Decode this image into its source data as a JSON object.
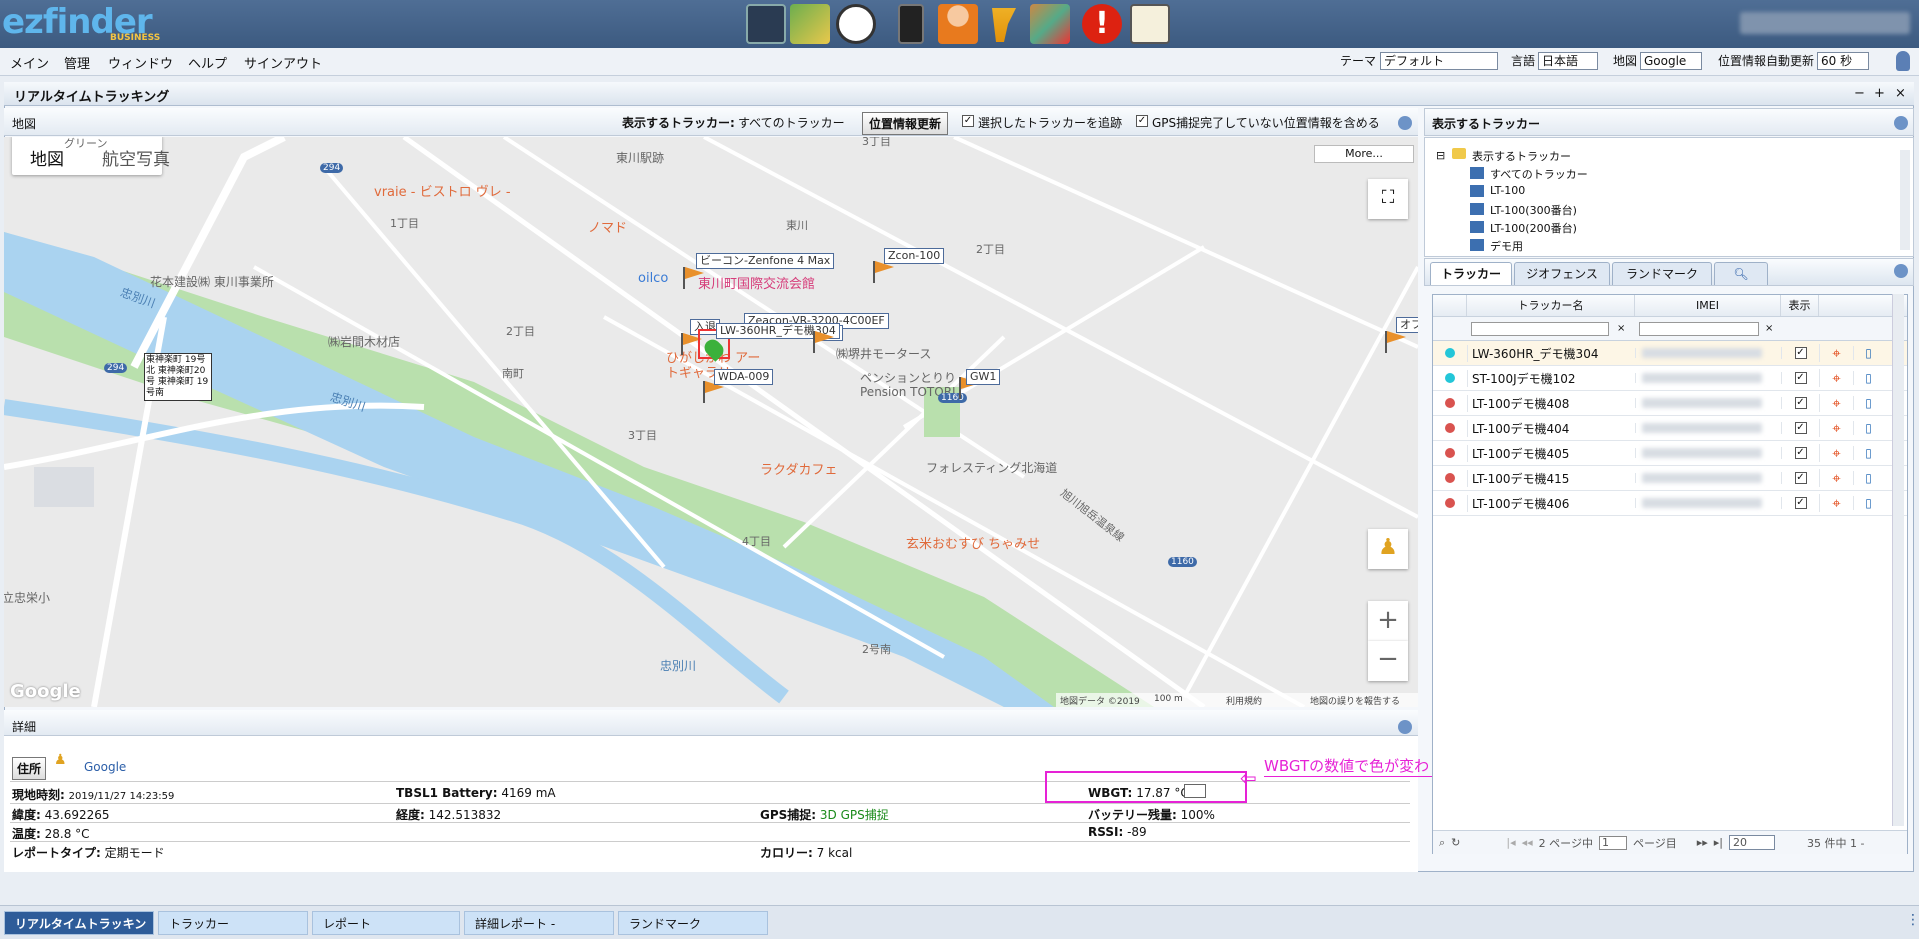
{
  "app": {
    "logo": "ezfinder",
    "logo_sub": "BUSINESS"
  },
  "menu": [
    "メイン",
    "管理",
    "ウィンドウ",
    "ヘルプ",
    "サインアウト"
  ],
  "settings": {
    "theme_label": "テーマ",
    "theme_value": "デフォルト",
    "lang_label": "言語",
    "lang_value": "日本語",
    "map_label": "地図",
    "map_value": "Google",
    "refresh_label": "位置情報自動更新",
    "refresh_value": "60 秒"
  },
  "window": {
    "title": "リアルタイムトラッキング"
  },
  "map_panel": {
    "title": "地図",
    "trackers_label": "表示するトラッカー:",
    "trackers_value": "すべてのトラッカー",
    "update_button": "位置情報更新",
    "follow_label": "選択したトラッカーを追跡",
    "include_label": "GPS捕捉完了していない位置情報を含める",
    "map_type": [
      "地図",
      "航空写真"
    ],
    "more": "More...",
    "footer": [
      "地図データ ©2019",
      "100 m",
      "利用規約",
      "地図の誤りを報告する"
    ],
    "trackers_on_map": [
      "ビーコン-Zenfone 4 Max",
      "Zcon-100",
      "LW-360HR_デモ機304",
      "Zeacon-VR-3200-4C00EF",
      "WDA-009",
      "GW1",
      "入退",
      "101",
      "オフ"
    ],
    "places": [
      "グリーン",
      "東川駅跡",
      "vraie - ビストロ ヴレ -",
      "ノマド",
      "oilco",
      "東川町国際交流会館",
      "花本建設㈱ 東川事業所",
      "㈱岩間木材店",
      "ひがしかわ アートギャラリー",
      "㈱堺井モータース",
      "ペンションとりり Pension TOTORI",
      "ラクダカフェ",
      "フォレスティング北海道",
      "玄米おむすび ちゃみせ",
      "忠別川",
      "立忠栄小",
      "東川",
      "1丁目",
      "2丁目",
      "3丁目",
      "4丁目",
      "南町",
      "2号南",
      "旭川旭岳温泉線",
      "東神楽町 19号北 東神楽町20号 東神楽町 19号南",
      "294",
      "1160",
      "Google",
      "3丁目"
    ]
  },
  "detail": {
    "title": "詳細",
    "address_button": "住所",
    "google_link": "Google",
    "fields": {
      "time_label": "現地時刻:",
      "time_value": "2019/11/27 14:23:59",
      "battery_label": "TBSL1 Battery:",
      "battery_value": "4169 mA",
      "wbgt_label": "WBGT:",
      "wbgt_value": "17.87 °C",
      "lat_label": "緯度:",
      "lat_value": "43.692265",
      "lng_label": "経度:",
      "lng_value": "142.513832",
      "gps_label": "GPS捕捉:",
      "gps_value": "3D GPS捕捉",
      "battery_rem_label": "バッテリー残量:",
      "battery_rem_value": "100%",
      "temp_label": "温度:",
      "temp_value": "28.8 °C",
      "rssi_label": "RSSI:",
      "rssi_value": "-89",
      "report_label": "レポートタイプ:",
      "report_value": "定期モード",
      "cal_label": "カロリー:",
      "cal_value": "7 kcal"
    },
    "annotation": "WBGTの数値で色が変わります"
  },
  "right_panel": {
    "title": "表示するトラッカー",
    "tree": [
      "表示するトラッカー",
      "すべてのトラッカー",
      "LT-100",
      "LT-100(300番台)",
      "LT-100(200番台)",
      "デモ用"
    ],
    "tabs": [
      "トラッカー",
      "ジオフェンス",
      "ランドマーク"
    ],
    "columns": [
      "トラッカー名",
      "IMEI",
      "表示"
    ],
    "rows": [
      {
        "name": "LW-360HR_デモ機304"
      },
      {
        "name": "ST-100Jデモ機102"
      },
      {
        "name": "LT-100デモ機408"
      },
      {
        "name": "LT-100デモ機404"
      },
      {
        "name": "LT-100デモ機405"
      },
      {
        "name": "LT-100デモ機415"
      },
      {
        "name": "LT-100デモ機406"
      }
    ],
    "pager": {
      "page_text": "2 ページ中",
      "page_value": "1",
      "page_suffix": "ページ目",
      "size": "20",
      "count": "35 件中 1 -"
    }
  },
  "bottom_tabs": [
    "リアルタイムトラッキン",
    "トラッカー",
    "レポート",
    "詳細レポート -",
    "ランドマーク"
  ],
  "colors": {
    "header": "#3c5a80",
    "accent": "#2b5ea8",
    "annotation": "#e622d6",
    "gps": "#1a8a1a"
  }
}
